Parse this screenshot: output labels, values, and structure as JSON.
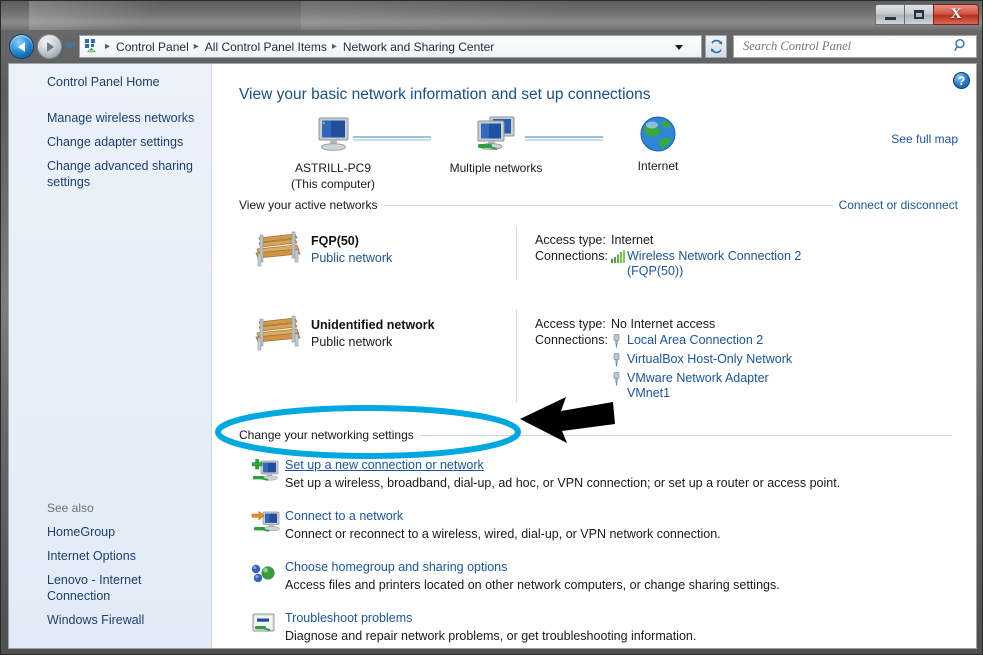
{
  "window": {
    "controls": {
      "minimize": "—",
      "maximize": "□",
      "close": "X"
    }
  },
  "addressbar": {
    "back_tooltip": "Back",
    "forward_tooltip": "Forward",
    "crumbs": [
      "Control Panel",
      "All Control Panel Items",
      "Network and Sharing Center"
    ],
    "separator": "▸",
    "refresh_icon": "refresh-icon",
    "search": {
      "placeholder": "Search Control Panel",
      "value": ""
    }
  },
  "sidebar": {
    "top_items": [
      {
        "label": "Control Panel Home"
      },
      {
        "label": "Manage wireless networks"
      },
      {
        "label": "Change adapter settings"
      },
      {
        "label": "Change advanced sharing settings"
      }
    ],
    "see_also_title": "See also",
    "see_also_items": [
      {
        "label": "HomeGroup"
      },
      {
        "label": "Internet Options"
      },
      {
        "label": "Lenovo - Internet Connection"
      },
      {
        "label": "Windows Firewall"
      }
    ]
  },
  "content": {
    "help_label": "?",
    "page_title": "View your basic network information and set up connections",
    "network_map": {
      "see_full_map": "See full map",
      "nodes": [
        {
          "icon": "computer-icon",
          "caption_line1": "ASTRILL-PC9",
          "caption_line2": "(This computer)"
        },
        {
          "icon": "multiple-networks-icon",
          "caption_line1": "Multiple networks",
          "caption_line2": ""
        },
        {
          "icon": "globe-internet-icon",
          "caption_line1": "Internet",
          "caption_line2": ""
        }
      ]
    },
    "active_networks": {
      "heading": "View your active networks",
      "action": "Connect or disconnect",
      "rows": [
        {
          "icon": "bench-network-icon",
          "name": "FQP(50)",
          "type": "Public network",
          "type_is_link": true,
          "access_type_label": "Access type:",
          "access_type_value": "Internet",
          "connections_label": "Connections:",
          "connections": [
            {
              "icon": "wireless-signal-icon",
              "label": "Wireless Network Connection 2 (FQP(50))"
            }
          ]
        },
        {
          "icon": "bench-network-icon",
          "name": "Unidentified network",
          "type": "Public network",
          "type_is_link": false,
          "access_type_label": "Access type:",
          "access_type_value": "No Internet access",
          "connections_label": "Connections:",
          "connections": [
            {
              "icon": "ethernet-plug-icon",
              "label": "Local Area Connection 2"
            },
            {
              "icon": "ethernet-plug-icon",
              "label": "VirtualBox Host-Only Network"
            },
            {
              "icon": "ethernet-plug-icon",
              "label": "VMware Network Adapter VMnet1"
            }
          ]
        }
      ]
    },
    "settings": {
      "heading": "Change your networking settings",
      "tasks": [
        {
          "icon": "new-connection-icon",
          "link": "Set up a new connection or network",
          "hovered": true,
          "description": "Set up a wireless, broadband, dial-up, ad hoc, or VPN connection; or set up a router or access point."
        },
        {
          "icon": "connect-network-icon",
          "link": "Connect to a network",
          "hovered": false,
          "description": "Connect or reconnect to a wireless, wired, dial-up, or VPN network connection."
        },
        {
          "icon": "homegroup-icon",
          "link": "Choose homegroup and sharing options",
          "hovered": false,
          "description": "Access files and printers located on other network computers, or change sharing settings."
        },
        {
          "icon": "troubleshoot-icon",
          "link": "Troubleshoot problems",
          "hovered": false,
          "description": "Diagnose and repair network problems, or get troubleshooting information."
        }
      ]
    }
  },
  "annotations": {
    "ellipse_color": "#00a8e0",
    "arrow_color": "#000000",
    "target": "Set up a new connection or network"
  }
}
